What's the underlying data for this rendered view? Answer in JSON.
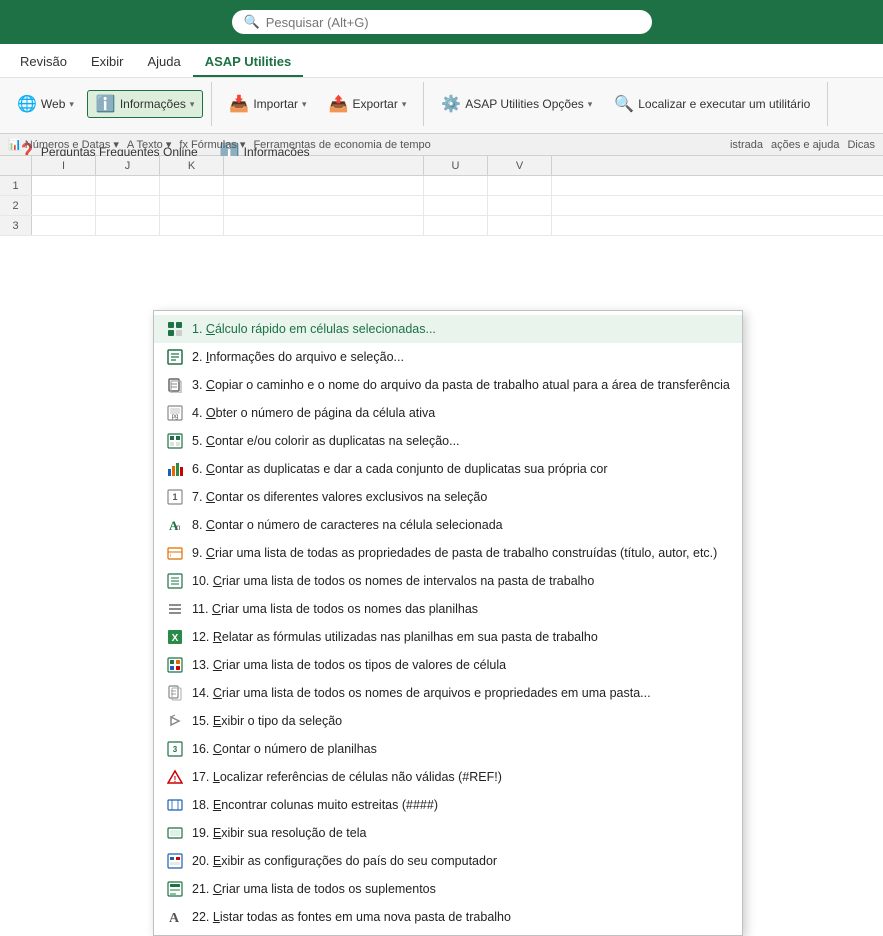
{
  "search": {
    "placeholder": "Pesquisar (Alt+G)"
  },
  "ribbon": {
    "tabs": [
      {
        "id": "revisao",
        "label": "Revisão"
      },
      {
        "id": "exibir",
        "label": "Exibir"
      },
      {
        "id": "ajuda",
        "label": "Ajuda"
      },
      {
        "id": "asap",
        "label": "ASAP Utilities",
        "active": true
      }
    ],
    "groups": {
      "group1": {
        "buttons": [
          {
            "label": "Web",
            "hasDropdown": true
          },
          {
            "label": "Informações",
            "hasDropdown": true,
            "active": true
          }
        ]
      },
      "group2": {
        "buttons": [
          {
            "label": "Importar",
            "hasDropdown": true
          },
          {
            "label": "Exportar",
            "hasDropdown": true
          }
        ]
      },
      "group3": {
        "buttons": [
          {
            "label": "ASAP Utilities Opções",
            "hasDropdown": true
          },
          {
            "label": "Localizar e executar um utilitário"
          }
        ]
      },
      "group4": {
        "buttons": [
          {
            "label": "Perguntas Frequentes Online"
          },
          {
            "label": "Informações"
          }
        ]
      }
    }
  },
  "formula_bar": {
    "content": "fx  Fórmulas"
  },
  "sub_toolbar": {
    "items": [
      "Números e Datas",
      "Texto",
      "Fórmulas",
      "Ferramentas de economia de tempo",
      "istrada",
      "ações e ajuda",
      "Dicas"
    ]
  },
  "columns": [
    "I",
    "J",
    "K",
    "U",
    "V"
  ],
  "menu": {
    "title": "Informações",
    "items": [
      {
        "num": "1.",
        "text": "Cálculo rápido em células selecionadas...",
        "underline": "C",
        "icon": "grid",
        "color": "teal",
        "highlighted": true
      },
      {
        "num": "2.",
        "text": "Informações do arquivo e seleção...",
        "underline": "I",
        "icon": "grid-info",
        "color": "teal"
      },
      {
        "num": "3.",
        "text": "Copiar o caminho e o nome do arquivo da pasta de trabalho atual para a área de transferência",
        "underline": "C",
        "icon": "doc-copy",
        "color": "gray"
      },
      {
        "num": "4.",
        "text": "Obter o número de página da célula ativa",
        "underline": "O",
        "icon": "grid-page",
        "color": "gray"
      },
      {
        "num": "5.",
        "text": "Contar e/ou colorir as duplicatas na seleção...",
        "underline": "C",
        "icon": "grid-dup",
        "color": "teal"
      },
      {
        "num": "6.",
        "text": "Contar as duplicatas e dar a cada conjunto de duplicatas sua própria cor",
        "underline": "C",
        "icon": "chart-multi",
        "color": "blue"
      },
      {
        "num": "7.",
        "text": "Contar os diferentes valores exclusivos na seleção",
        "underline": "C",
        "icon": "grid-unique",
        "color": "gray"
      },
      {
        "num": "8.",
        "text": "Contar o número de caracteres na célula selecionada",
        "underline": "C",
        "icon": "text-a",
        "color": "teal"
      },
      {
        "num": "9.",
        "text": "Criar uma lista de todas as propriedades de pasta de trabalho construídas (título, autor, etc.)",
        "underline": "C",
        "icon": "list-props",
        "color": "orange"
      },
      {
        "num": "10.",
        "text": "Criar uma lista de todos os nomes de intervalos na pasta de trabalho",
        "underline": "C",
        "icon": "grid-names",
        "color": "teal"
      },
      {
        "num": "11.",
        "text": "Criar uma lista de todos os nomes das planilhas",
        "underline": "C",
        "icon": "list-lines",
        "color": "gray"
      },
      {
        "num": "12.",
        "text": "Relatar as fórmulas utilizadas nas planilhas em sua pasta de trabalho",
        "underline": "R",
        "icon": "excel-x",
        "color": "green"
      },
      {
        "num": "13.",
        "text": "Criar uma lista de todos os tipos de valores de célula",
        "underline": "C",
        "icon": "grid-cal",
        "color": "teal"
      },
      {
        "num": "14.",
        "text": "Criar uma lista de todos os nomes de arquivos e propriedades em uma pasta...",
        "underline": "C",
        "icon": "doc-list",
        "color": "gray"
      },
      {
        "num": "15.",
        "text": "Exibir o tipo da seleção",
        "underline": "E",
        "icon": "cursor-arrow",
        "color": "gray"
      },
      {
        "num": "16.",
        "text": "Contar o número de planilhas",
        "underline": "C",
        "icon": "grid-count",
        "color": "teal"
      },
      {
        "num": "17.",
        "text": "Localizar referências de células não válidas (#REF!)",
        "underline": "L",
        "icon": "warning-red",
        "color": "red"
      },
      {
        "num": "18.",
        "text": "Encontrar colunas muito estreitas (####)",
        "underline": "E",
        "icon": "grid-narrow",
        "color": "blue"
      },
      {
        "num": "19.",
        "text": "Exibir sua resolução de tela",
        "underline": "E",
        "icon": "grid-res",
        "color": "teal"
      },
      {
        "num": "20.",
        "text": "Exibir as configurações do país do seu computador",
        "underline": "E",
        "icon": "grid-country",
        "color": "blue"
      },
      {
        "num": "21.",
        "text": "Criar uma lista de todos os suplementos",
        "underline": "C",
        "icon": "grid-supp",
        "color": "teal"
      },
      {
        "num": "22.",
        "text": "Listar todas as fontes em uma nova pasta de trabalho",
        "underline": "L",
        "icon": "text-A2",
        "color": "gray"
      }
    ]
  }
}
